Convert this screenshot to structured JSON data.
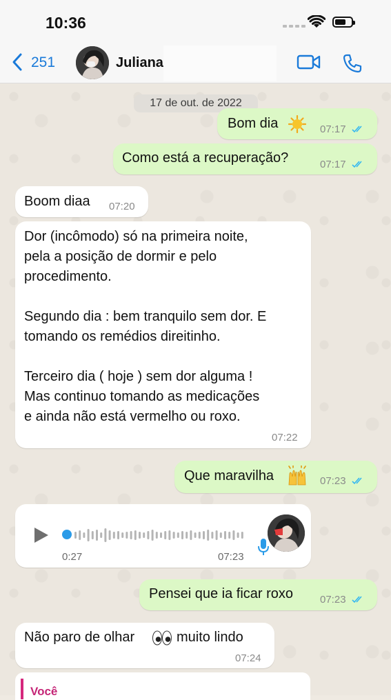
{
  "status_bar": {
    "time": "10:36",
    "battery_level": 0.7
  },
  "header": {
    "back_count": "251",
    "contact_name": "Juliana L",
    "icons": [
      "chevron-left-icon",
      "video-call-icon",
      "phone-call-icon"
    ],
    "accent_color": "#1a7ad9"
  },
  "date_chip": "17 de out. de 2022",
  "messages": [
    {
      "dir": "out",
      "text": "Bom dia",
      "emoji": "sun-emoji",
      "time": "07:17",
      "status": "read"
    },
    {
      "dir": "out",
      "text": "Como está a recuperação?",
      "time": "07:17",
      "status": "read"
    },
    {
      "dir": "in",
      "text": "Boom diaa",
      "time": "07:20"
    },
    {
      "dir": "in",
      "lines": [
        "Dor (incômodo) só na primeira noite,",
        "pela a posição de dormir e pelo",
        "procedimento.",
        "",
        "Segundo dia : bem tranquilo sem dor. E",
        "tomando os remédios direitinho.",
        "",
        "Terceiro dia ( hoje ) sem dor alguma !",
        "Mas continuo tomando as medicações",
        "e ainda não está vermelho ou roxo."
      ],
      "time": "07:22"
    },
    {
      "dir": "out",
      "text": "Que maravilha",
      "emoji": "raised-hands-emoji",
      "time": "07:23",
      "status": "read"
    },
    {
      "dir": "in",
      "type": "audio",
      "elapsed": "0:27",
      "time": "07:23",
      "progress": 0.0
    },
    {
      "dir": "out",
      "text": "Pensei que ia ficar roxo",
      "time": "07:23",
      "status": "read"
    },
    {
      "dir": "in",
      "text_before": "Não paro de olhar",
      "emoji": "eyes-emoji",
      "text_after": "muito lindo",
      "time": "07:24"
    }
  ],
  "quote_preview": {
    "author": "Você"
  },
  "colors": {
    "outgoing_bubble": "#dcf8c6",
    "incoming_bubble": "#ffffff",
    "read_ticks": "#34b7f1",
    "quote_accent": "#c52677"
  }
}
